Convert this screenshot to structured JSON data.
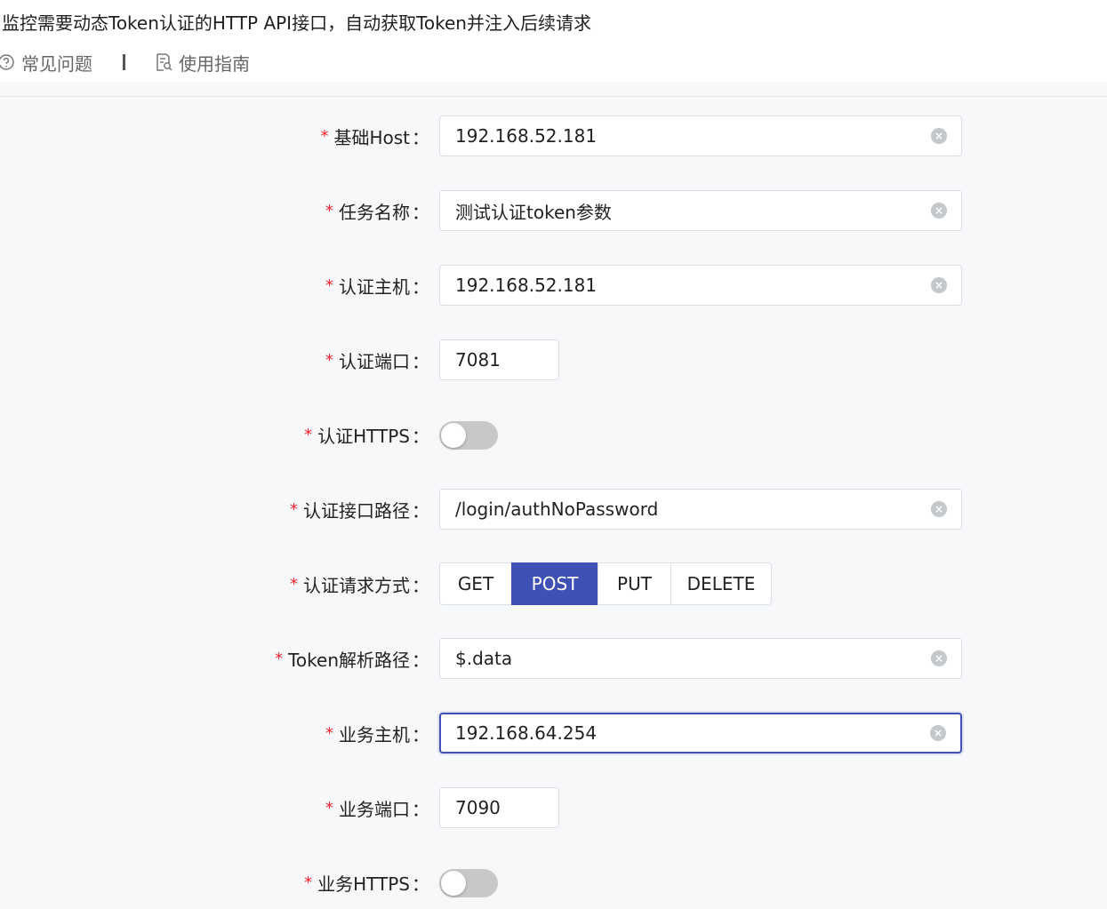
{
  "header": {
    "description": "监控需要动态Token认证的HTTP API接口，自动获取Token并注入后续请求",
    "faq_label": "常见问题",
    "guide_label": "使用指南",
    "faq_icon": "question-circle-icon",
    "guide_icon": "document-search-icon"
  },
  "form": {
    "required_mark": "*",
    "colon": "：",
    "base_host": {
      "label": "基础Host",
      "value": "192.168.52.181"
    },
    "task_name": {
      "label": "任务名称",
      "value": "测试认证token参数"
    },
    "auth_host": {
      "label": "认证主机",
      "value": "192.168.52.181"
    },
    "auth_port": {
      "label": "认证端口",
      "value": "7081"
    },
    "auth_https": {
      "label": "认证HTTPS",
      "checked": false
    },
    "auth_path": {
      "label": "认证接口路径",
      "value": "/login/authNoPassword"
    },
    "auth_method": {
      "label": "认证请求方式",
      "options": [
        "GET",
        "POST",
        "PUT",
        "DELETE"
      ],
      "selected": "POST"
    },
    "token_path": {
      "label": "Token解析路径",
      "value": "$.data"
    },
    "biz_host": {
      "label": "业务主机",
      "value": "192.168.64.254"
    },
    "biz_port": {
      "label": "业务端口",
      "value": "7090"
    },
    "biz_https": {
      "label": "业务HTTPS",
      "checked": false
    },
    "clear_icon": "close-circle-icon"
  },
  "colors": {
    "primary": "#3f51b5",
    "required": "#f5222d",
    "switch_off": "#c8c8c8",
    "background": "#f7f8fa"
  }
}
